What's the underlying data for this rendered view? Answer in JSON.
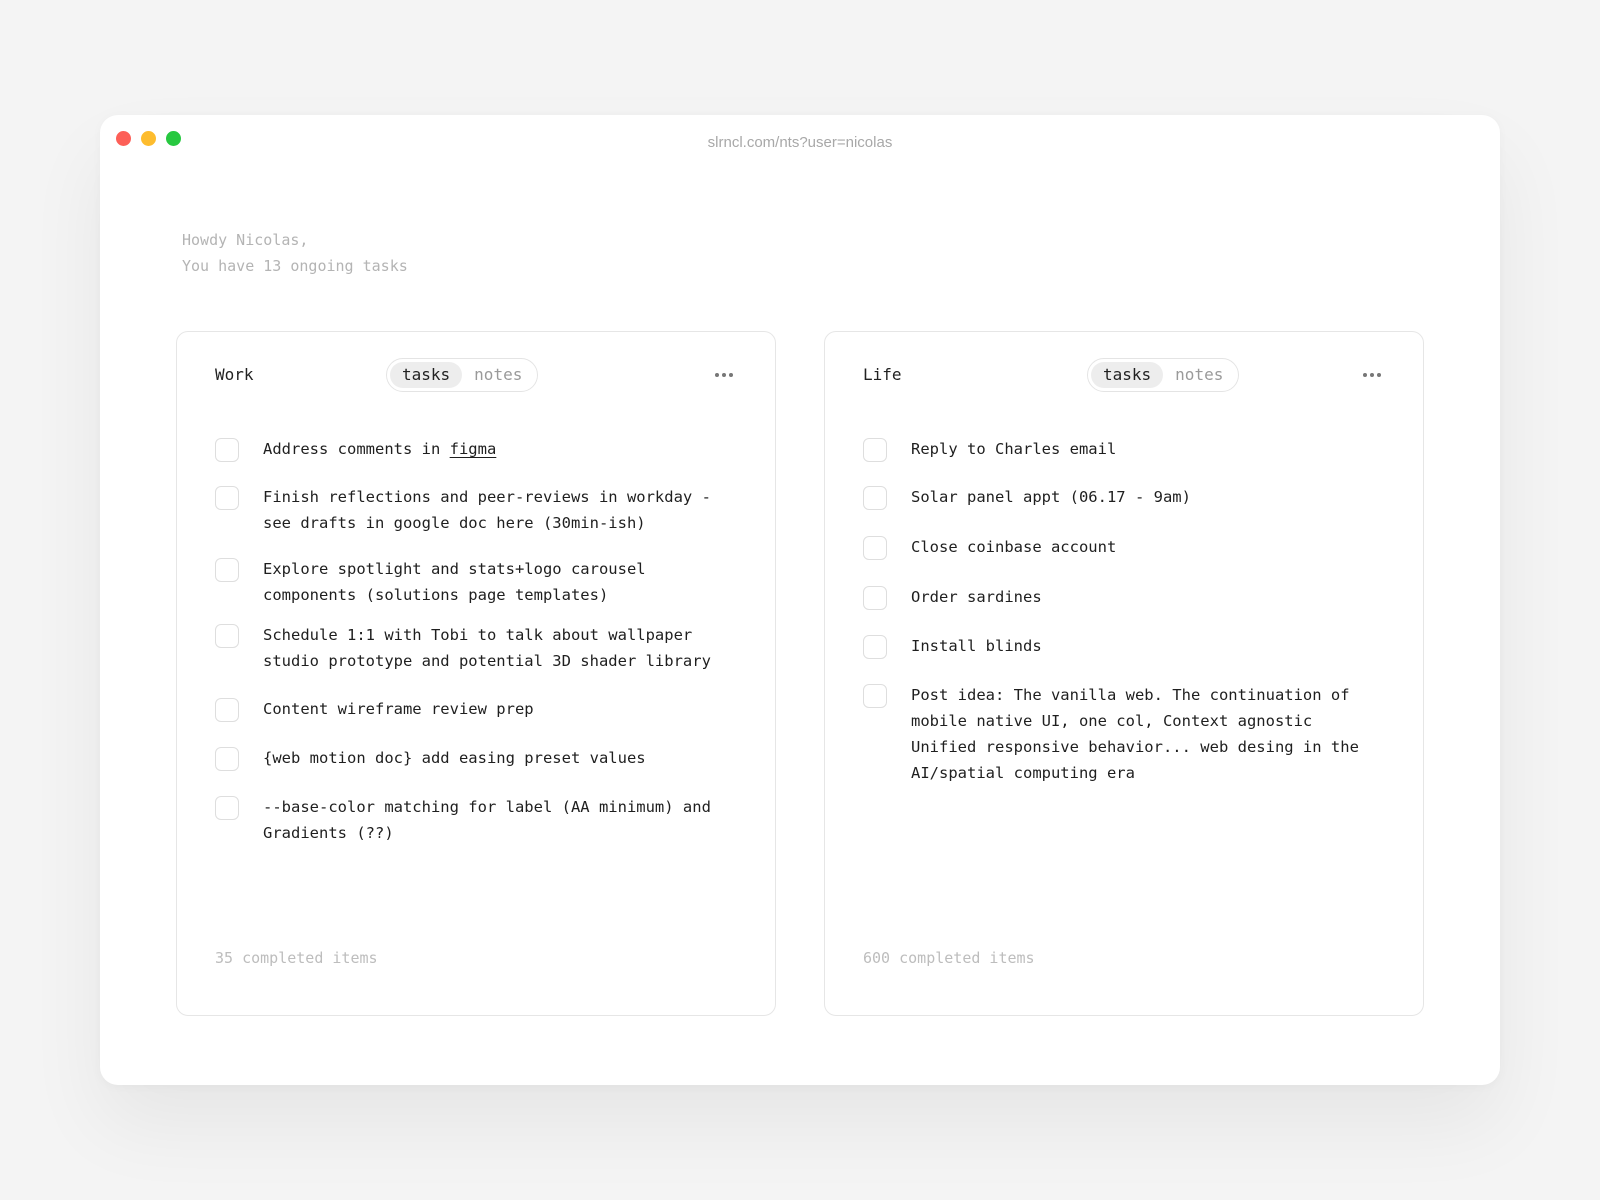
{
  "window": {
    "url": "slrncl.com/nts?user=nicolas"
  },
  "greeting": {
    "line1": "Howdy Nicolas,",
    "line2": "You have 13 ongoing tasks"
  },
  "work": {
    "title": "Work",
    "tab_tasks": "tasks",
    "tab_notes": "notes",
    "active_tab": "tasks",
    "more_icon": "more-horizontal-icon",
    "items": [
      {
        "text": "Address comments in ",
        "link": "figma",
        "checked": false
      },
      {
        "text": "Finish reflections and peer-reviews in workday -\nsee drafts in google doc here (30min-ish)",
        "checked": false
      },
      {
        "text": "Explore spotlight and stats+logo carousel\ncomponents (solutions page templates)",
        "checked": false
      },
      {
        "text": "Schedule 1:1 with Tobi to talk about wallpaper\nstudio prototype and potential 3D shader library",
        "checked": false
      },
      {
        "text": "Content wireframe review prep",
        "checked": false
      },
      {
        "text": "{web motion doc} add easing preset values",
        "checked": false
      },
      {
        "text": "--base-color matching for label (AA minimum) and\nGradients (??)",
        "checked": false
      }
    ],
    "completed": "35 completed items"
  },
  "life": {
    "title": "Life",
    "tab_tasks": "tasks",
    "tab_notes": "notes",
    "active_tab": "tasks",
    "more_icon": "more-horizontal-icon",
    "items": [
      {
        "text": "Reply to Charles email",
        "checked": false
      },
      {
        "text": "Solar panel appt (06.17 - 9am)",
        "checked": false
      },
      {
        "text": "Close coinbase account",
        "checked": false
      },
      {
        "text": "Order sardines",
        "checked": false
      },
      {
        "text": "Install blinds",
        "checked": false
      },
      {
        "text": "Post idea: The vanilla web. The continuation of\nmobile native UI, one col, Context agnostic\nUnified responsive behavior... web desing in the\nAI/spatial computing era",
        "checked": false
      }
    ],
    "completed": "600 completed items"
  },
  "colors": {
    "close": "#fd5f57",
    "minimize": "#fdbc2e",
    "maximize": "#27c840"
  }
}
